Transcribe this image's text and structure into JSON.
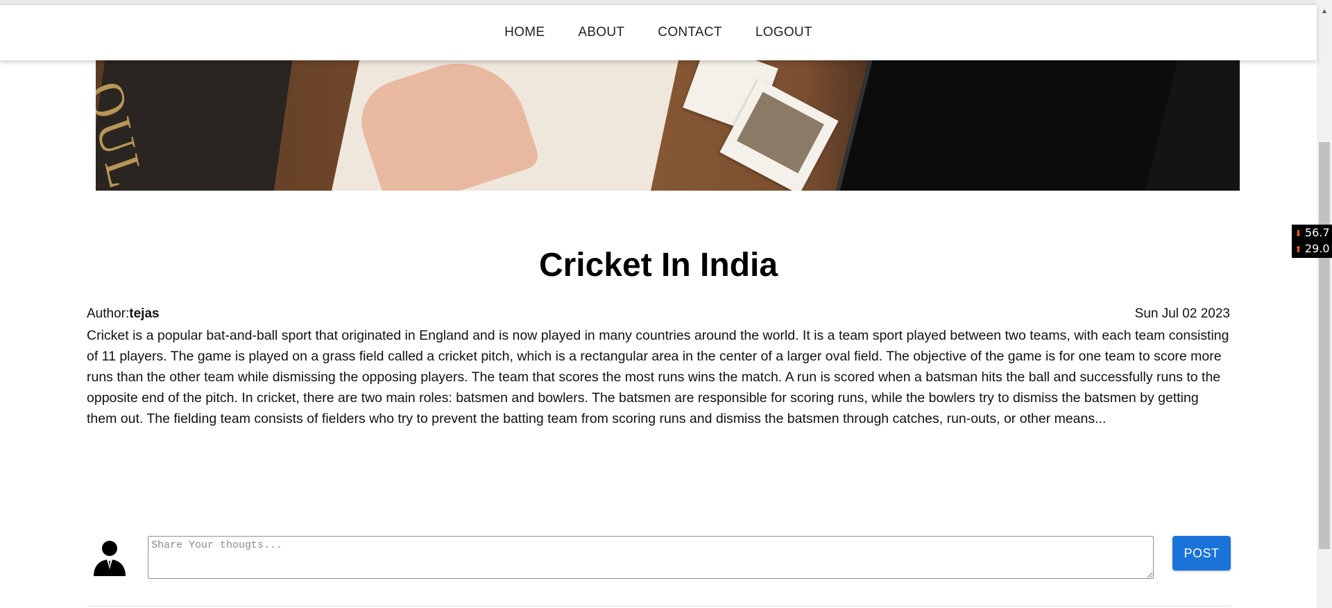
{
  "nav": {
    "items": [
      {
        "label": "HOME"
      },
      {
        "label": "ABOUT"
      },
      {
        "label": "CONTACT"
      },
      {
        "label": "LOGOUT"
      }
    ]
  },
  "hero": {
    "icon": "hero-image",
    "book_text": "OUL"
  },
  "post": {
    "title": "Cricket In India",
    "author_label": "Author:",
    "author_name": "tejas",
    "date": "Sun Jul 02 2023",
    "body": "Cricket is a popular bat-and-ball sport that originated in England and is now played in many countries around the world. It is a team sport played between two teams, with each team consisting of 11 players. The game is played on a grass field called a cricket pitch, which is a rectangular area in the center of a larger oval field. The objective of the game is for one team to score more runs than the other team while dismissing the opposing players. The team that scores the most runs wins the match. A run is scored when a batsman hits the ball and successfully runs to the opposite end of the pitch. In cricket, there are two main roles: batsmen and bowlers. The batsmen are responsible for scoring runs, while the bowlers try to dismiss the batsmen by getting them out. The fielding team consists of fielders who try to prevent the batting team from scoring runs and dismiss the batsmen through catches, run-outs, or other means..."
  },
  "comment": {
    "avatar_icon": "user-avatar-icon",
    "placeholder": "Share Your thougts...",
    "value": "",
    "post_label": "POST"
  },
  "net_monitor": {
    "download": "56.7",
    "upload": "29.0",
    "download_icon": "arrow-down-icon",
    "upload_icon": "arrow-up-icon"
  },
  "colors": {
    "accent": "#1a73d9",
    "nav_text": "#222222",
    "background": "#ffffff"
  }
}
